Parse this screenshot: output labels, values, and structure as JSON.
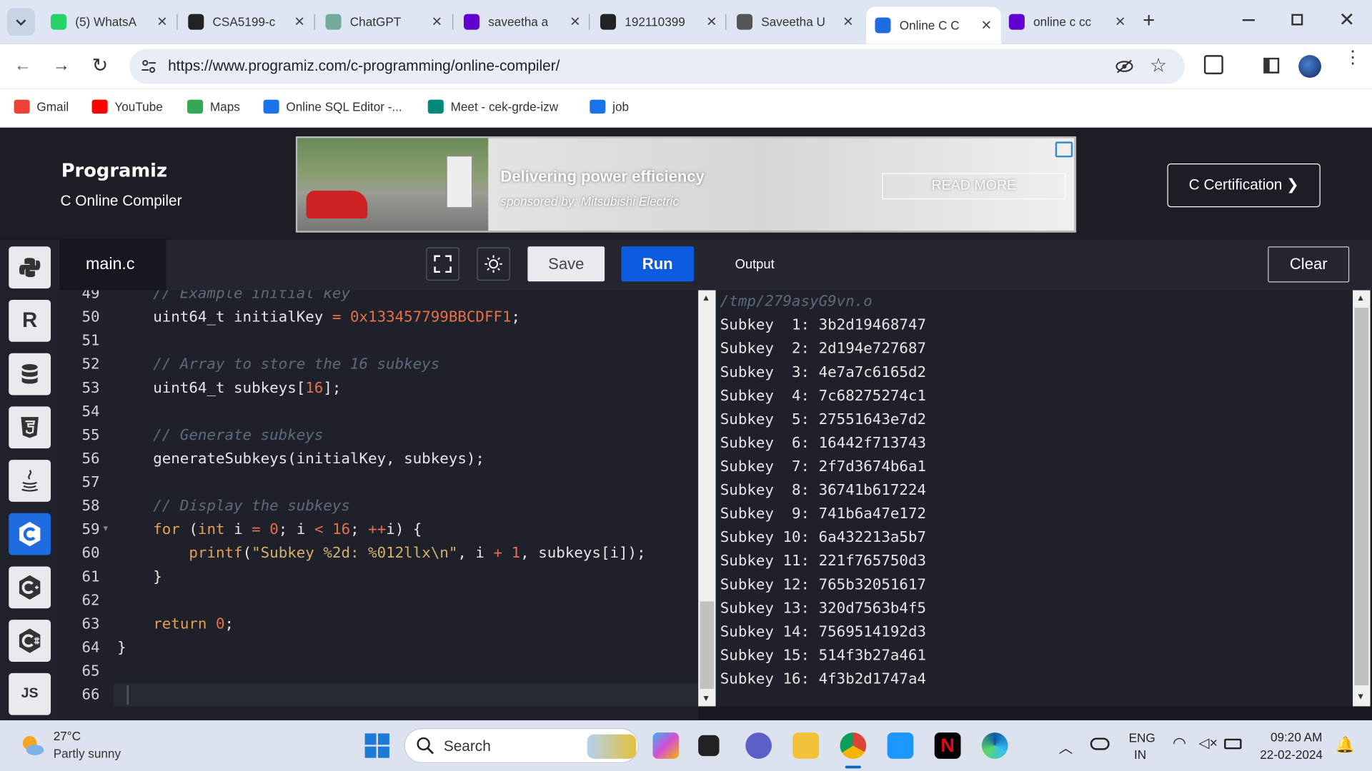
{
  "browser": {
    "tabs": [
      {
        "title": "(5) WhatsA",
        "icon": "whatsapp-icon",
        "color": "#25d366"
      },
      {
        "title": "CSA5199-c",
        "icon": "github-icon",
        "color": "#222222"
      },
      {
        "title": "ChatGPT",
        "icon": "chatgpt-icon",
        "color": "#74aa9c"
      },
      {
        "title": "saveetha a",
        "icon": "yahoo-icon",
        "color": "#6001d2"
      },
      {
        "title": "192110399",
        "icon": "github-icon",
        "color": "#222222"
      },
      {
        "title": "Saveetha U",
        "icon": "globe-icon",
        "color": "#555555"
      },
      {
        "title": "Online C C",
        "icon": "programiz-icon",
        "color": "#1f6ce0"
      },
      {
        "title": "online c cc",
        "icon": "yahoo-icon",
        "color": "#6001d2"
      }
    ],
    "new_tab": "+",
    "url": "https://www.programiz.com/c-programming/online-compiler/",
    "bookmarks": [
      {
        "label": "Gmail",
        "icon": "gmail-icon"
      },
      {
        "label": "YouTube",
        "icon": "youtube-icon"
      },
      {
        "label": "Maps",
        "icon": "maps-icon"
      },
      {
        "label": "Online SQL Editor -...",
        "icon": "sql-editor-icon"
      },
      {
        "label": "Meet - cek-grde-izw",
        "icon": "meet-icon"
      },
      {
        "label": "job",
        "icon": "job-icon"
      }
    ]
  },
  "site": {
    "logo": "Programiz",
    "subtitle": "C Online Compiler",
    "ad": {
      "headline": "Delivering power efficiency",
      "sponsor": "sponsored by: Mitsubishi Electric",
      "button": "READ MORE"
    },
    "cert_button": "C Certification ❯"
  },
  "sidebar": {
    "languages": [
      "python",
      "r",
      "sql",
      "html",
      "java",
      "c",
      "c++",
      "c#",
      "JS"
    ]
  },
  "editor": {
    "filename": "main.c",
    "save_label": "Save",
    "run_label": "Run",
    "lines": [
      {
        "n": "49",
        "html": "<span class=\"cmt\">    // Example initial key</span>"
      },
      {
        "n": "50",
        "html": "    uint64_t initialKey <span class=\"op\">=</span> <span class=\"num\">0x133457799BBCDFF1</span>;"
      },
      {
        "n": "51",
        "html": ""
      },
      {
        "n": "52",
        "html": "<span class=\"cmt\">    // Array to store the 16 subkeys</span>"
      },
      {
        "n": "53",
        "html": "    uint64_t subkeys[<span class=\"num\">16</span>];"
      },
      {
        "n": "54",
        "html": ""
      },
      {
        "n": "55",
        "html": "<span class=\"cmt\">    // Generate subkeys</span>"
      },
      {
        "n": "56",
        "html": "    generateSubkeys(initialKey, subkeys);"
      },
      {
        "n": "57",
        "html": ""
      },
      {
        "n": "58",
        "html": "<span class=\"cmt\">    // Display the subkeys</span>"
      },
      {
        "n": "59",
        "html": "    <span class=\"kw\">for</span> (<span class=\"kw\">int</span> i <span class=\"op\">=</span> <span class=\"num\">0</span>; i <span class=\"op\">&lt;</span> <span class=\"num\">16</span>; <span class=\"op\">++</span>i) {"
      },
      {
        "n": "60",
        "html": "        <span class=\"kw\">printf</span>(<span class=\"str\">\"Subkey %2d: %012llx\\n\"</span>, i <span class=\"op\">+</span> <span class=\"num\">1</span>, subkeys[i]);"
      },
      {
        "n": "61",
        "html": "    }"
      },
      {
        "n": "62",
        "html": ""
      },
      {
        "n": "63",
        "html": "    <span class=\"kw\">return</span> <span class=\"num\">0</span>;"
      },
      {
        "n": "64",
        "html": "}"
      },
      {
        "n": "65",
        "html": ""
      },
      {
        "n": "66",
        "html": ""
      }
    ]
  },
  "output": {
    "label": "Output",
    "clear_label": "Clear",
    "path": "/tmp/279asyG9vn.o",
    "lines": [
      "Subkey  1: 3b2d19468747",
      "Subkey  2: 2d194e727687",
      "Subkey  3: 4e7a7c6165d2",
      "Subkey  4: 7c68275274c1",
      "Subkey  5: 27551643e7d2",
      "Subkey  6: 16442f713743",
      "Subkey  7: 2f7d3674b6a1",
      "Subkey  8: 36741b617224",
      "Subkey  9: 741b6a47e172",
      "Subkey 10: 6a432213a5b7",
      "Subkey 11: 221f765750d3",
      "Subkey 12: 765b32051617",
      "Subkey 13: 320d7563b4f5",
      "Subkey 14: 7569514192d3",
      "Subkey 15: 514f3b27a461",
      "Subkey 16: 4f3b2d1747a4"
    ]
  },
  "taskbar": {
    "weather_temp": "27°C",
    "weather_desc": "Partly sunny",
    "search_placeholder": "Search",
    "lang_top": "ENG",
    "lang_bottom": "IN",
    "time": "09:20 AM",
    "date": "22-02-2024"
  }
}
